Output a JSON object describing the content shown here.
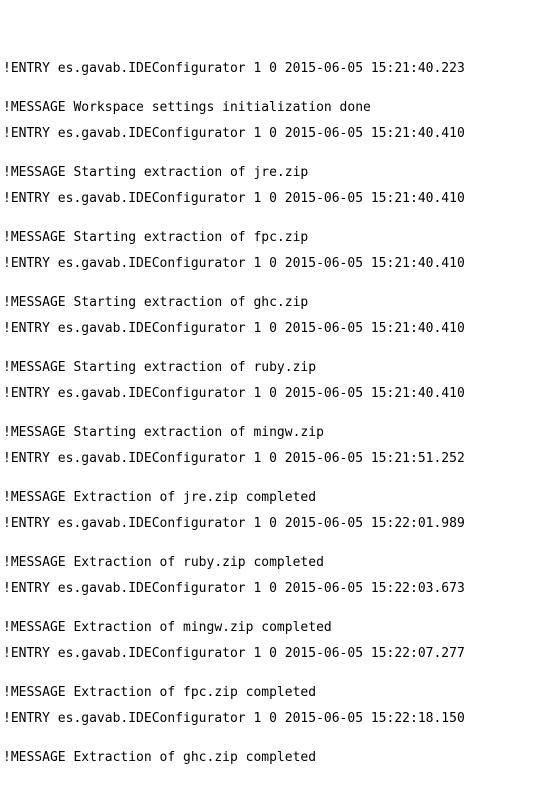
{
  "log": {
    "entries": [
      {
        "entry": "!ENTRY es.gavab.IDEConfigurator 1 0 2015-06-05 15:21:40.223",
        "message": "!MESSAGE Workspace settings initialization done"
      },
      {
        "entry": "!ENTRY es.gavab.IDEConfigurator 1 0 2015-06-05 15:21:40.410",
        "message": "!MESSAGE Starting extraction of jre.zip"
      },
      {
        "entry": "!ENTRY es.gavab.IDEConfigurator 1 0 2015-06-05 15:21:40.410",
        "message": "!MESSAGE Starting extraction of fpc.zip"
      },
      {
        "entry": "!ENTRY es.gavab.IDEConfigurator 1 0 2015-06-05 15:21:40.410",
        "message": "!MESSAGE Starting extraction of ghc.zip"
      },
      {
        "entry": "!ENTRY es.gavab.IDEConfigurator 1 0 2015-06-05 15:21:40.410",
        "message": "!MESSAGE Starting extraction of ruby.zip"
      },
      {
        "entry": "!ENTRY es.gavab.IDEConfigurator 1 0 2015-06-05 15:21:40.410",
        "message": "!MESSAGE Starting extraction of mingw.zip"
      },
      {
        "entry": "!ENTRY es.gavab.IDEConfigurator 1 0 2015-06-05 15:21:51.252",
        "message": "!MESSAGE Extraction of jre.zip completed"
      },
      {
        "entry": "!ENTRY es.gavab.IDEConfigurator 1 0 2015-06-05 15:22:01.989",
        "message": "!MESSAGE Extraction of ruby.zip completed"
      },
      {
        "entry": "!ENTRY es.gavab.IDEConfigurator 1 0 2015-06-05 15:22:03.673",
        "message": "!MESSAGE Extraction of mingw.zip completed"
      },
      {
        "entry": "!ENTRY es.gavab.IDEConfigurator 1 0 2015-06-05 15:22:07.277",
        "message": "!MESSAGE Extraction of fpc.zip completed"
      },
      {
        "entry": "!ENTRY es.gavab.IDEConfigurator 1 0 2015-06-05 15:22:18.150",
        "message": "!MESSAGE Extraction of ghc.zip completed"
      }
    ]
  }
}
